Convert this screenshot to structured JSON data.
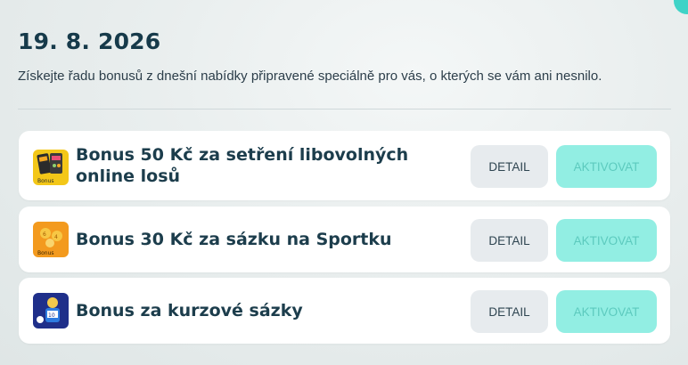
{
  "header": {
    "date": "19. 8. 2026",
    "subtitle": "Získejte řadu bonusů z dnešní nabídky připravené speciálně pro vás, o kterých se vám ani nesnilo."
  },
  "bonuses": [
    {
      "title": "Bonus 50 Kč za setření libovolných online losů",
      "detail_label": "DETAIL",
      "activate_label": "AKTIVOVAT",
      "thumb_caption": "Bonus"
    },
    {
      "title": "Bonus 30 Kč za sázku na Sportku",
      "detail_label": "DETAIL",
      "activate_label": "AKTIVOVAT",
      "thumb_caption": "Bonus"
    },
    {
      "title": "Bonus za kurzové sázky",
      "detail_label": "DETAIL",
      "activate_label": "AKTIVOVAT"
    }
  ],
  "colors": {
    "accent": "#92eee3",
    "accent_text": "#5ccabe",
    "title_text": "#1c3d4c",
    "detail_bg": "#e7ebee"
  },
  "icons": [
    "scratch-tickets-icon",
    "sportka-balls-icon",
    "football-player-icon"
  ]
}
